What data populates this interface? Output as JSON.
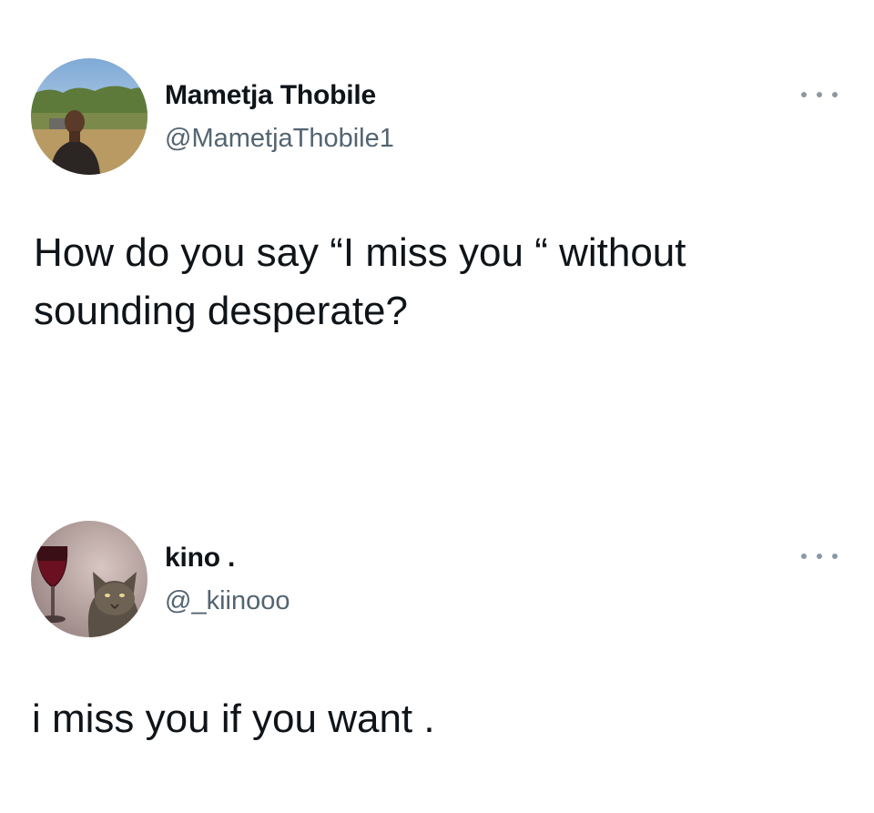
{
  "tweets": [
    {
      "author": {
        "name": "Mametja Thobile",
        "handle": "@MametjaThobile1",
        "avatar": "person-outdoors-photo"
      },
      "text": "How do you say “I miss you “ without sounding desperate?",
      "more_icon": "more-options-icon"
    },
    {
      "author": {
        "name": "kino .",
        "handle": "@_kiinooo",
        "avatar": "cat-with-wine-glass-photo"
      },
      "text": "i miss you if you want .",
      "more_icon": "more-options-icon"
    }
  ],
  "colors": {
    "background": "#ffffff",
    "text": "#0f1419",
    "secondary_text": "#536471",
    "icon_gray": "#8b98a5"
  }
}
